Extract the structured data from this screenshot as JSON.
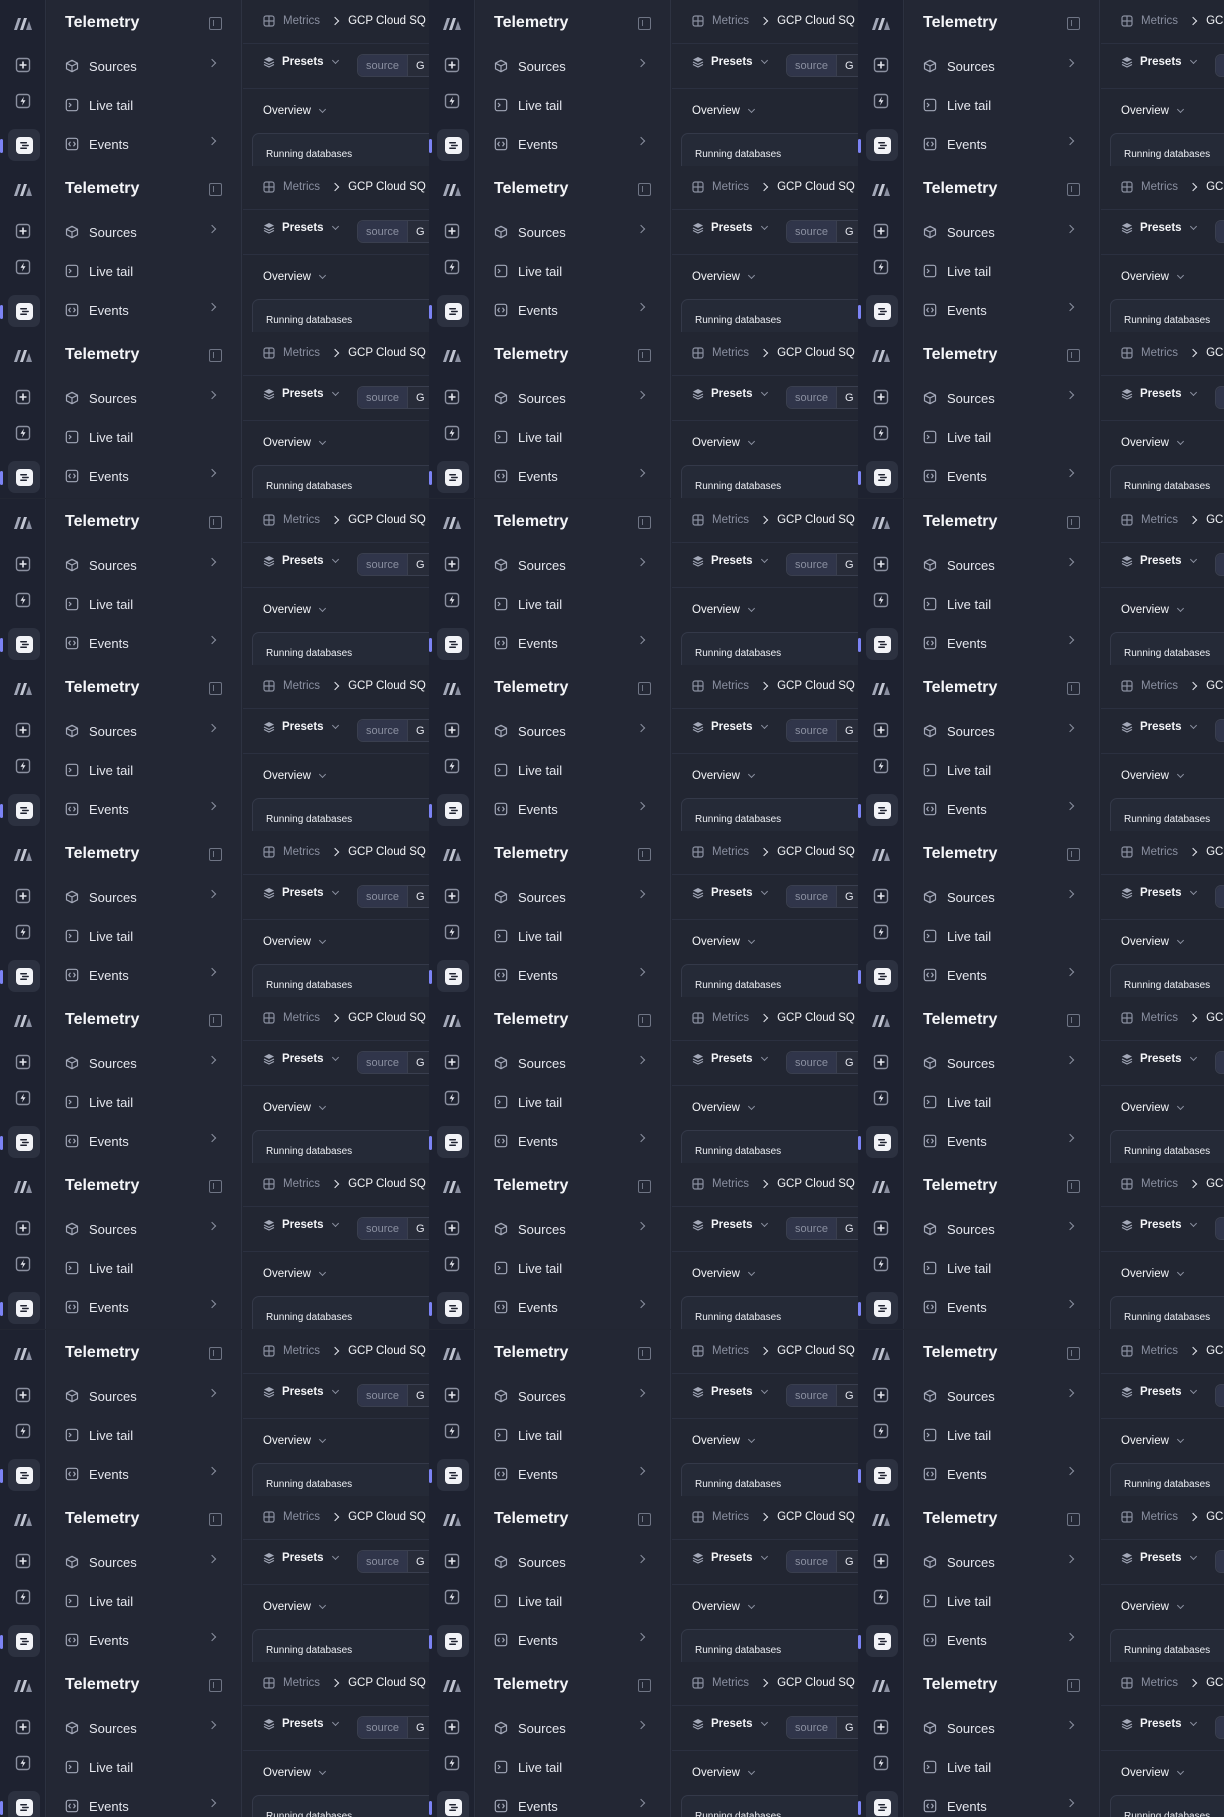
{
  "app": {
    "title": "Telemetry"
  },
  "sidebar": {
    "items": [
      {
        "label": "Sources",
        "icon": "box-icon",
        "has_chevron": true
      },
      {
        "label": "Live tail",
        "icon": "terminal-icon",
        "has_chevron": false
      },
      {
        "label": "Events",
        "icon": "code-icon",
        "has_chevron": true
      }
    ]
  },
  "rail": {
    "icons": [
      "logo-icon",
      "plus-square-icon",
      "bolt-icon",
      "dashboard-icon"
    ]
  },
  "breadcrumb": {
    "parent": "Metrics",
    "current": "GCP Cloud SQ"
  },
  "toolbar": {
    "presets_label": "Presets",
    "filter_key": "source",
    "filter_value": "G"
  },
  "overview": {
    "label": "Overview"
  },
  "card": {
    "title": "Running databases"
  },
  "colors": {
    "background": "#222632",
    "accent": "#7c83f5",
    "text": "#e5e7ee",
    "muted": "#8a8fa0"
  }
}
